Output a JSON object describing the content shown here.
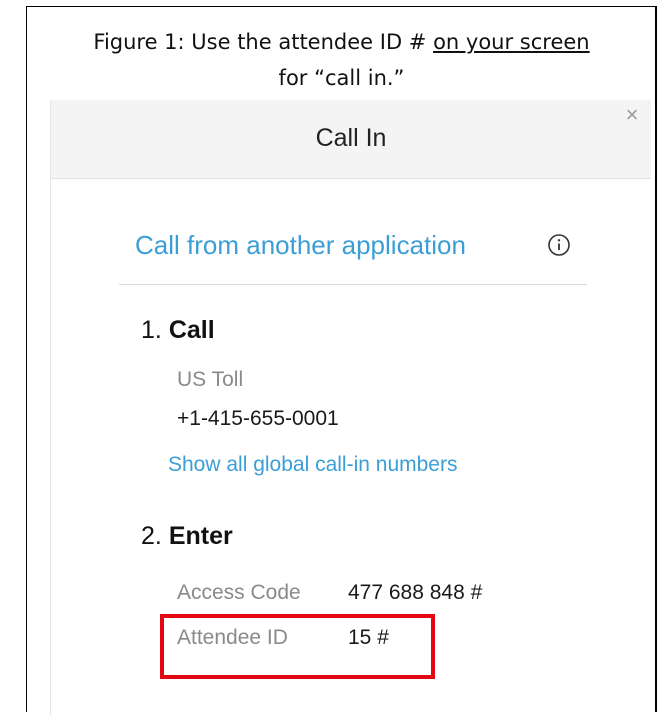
{
  "caption": {
    "line1_prefix": "Figure 1: Use the attendee ID # ",
    "line1_underlined": "on your screen",
    "line2": "for “call in.”"
  },
  "dialog": {
    "title": "Call In",
    "close_icon": "close-icon",
    "call_app_link": "Call from another application",
    "info_icon": "info-icon",
    "step1": {
      "number": "1.",
      "label": "Call"
    },
    "toll_label": "US Toll",
    "toll_number": "+1-415-655-0001",
    "global_link": "Show all global call-in numbers",
    "step2": {
      "number": "2.",
      "label": "Enter"
    },
    "access_code_label": "Access Code",
    "access_code_value": "477 688 848 #",
    "attendee_id_label": "Attendee ID",
    "attendee_id_value": "15 #"
  },
  "colors": {
    "link": "#3b9fd6",
    "highlight": "#e30613",
    "header_bg": "#f4f4f4"
  }
}
